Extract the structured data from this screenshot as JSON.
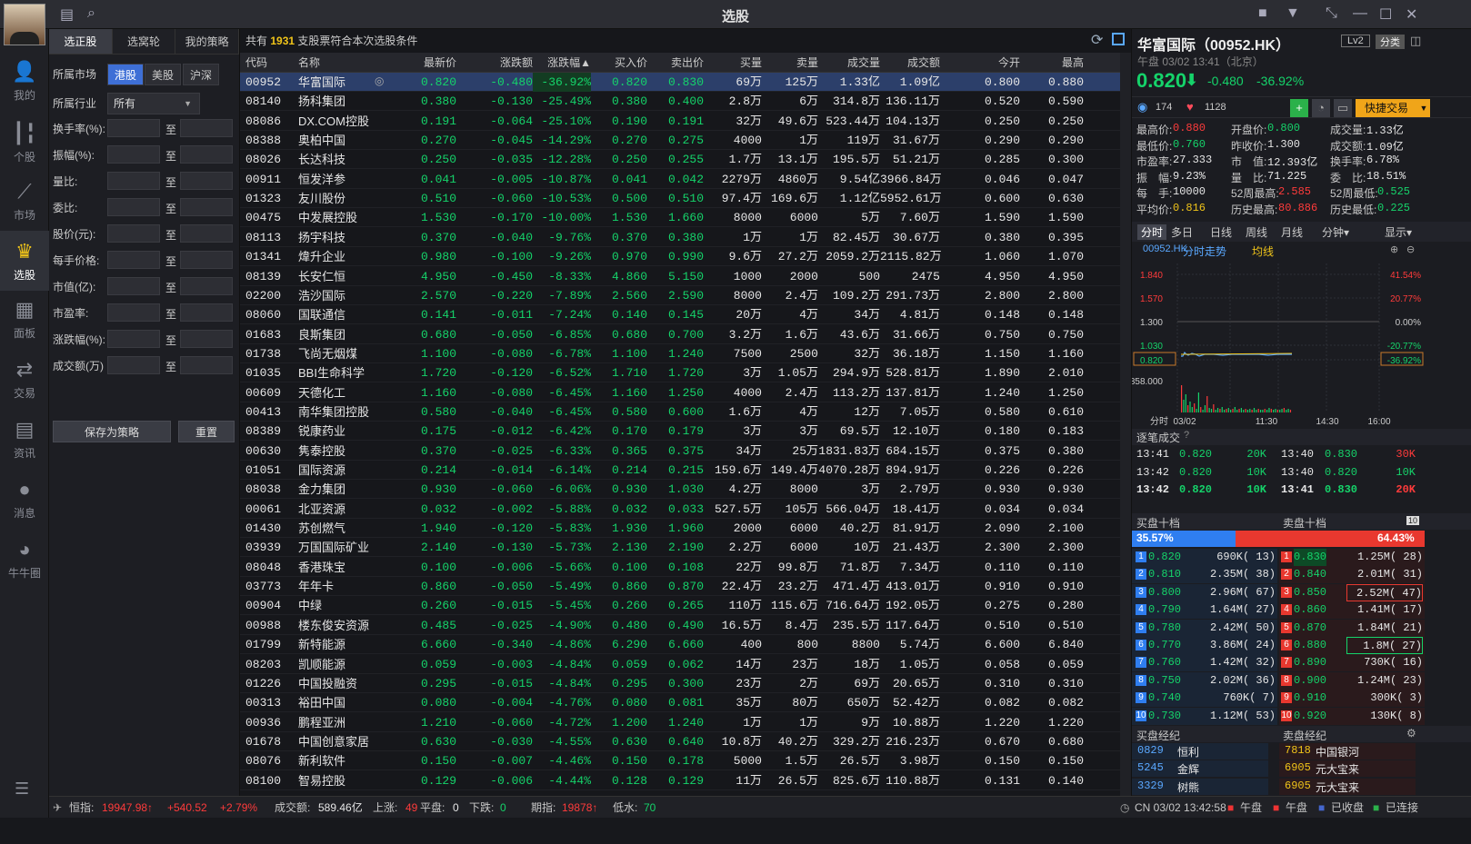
{
  "app": {
    "title": "选股"
  },
  "nav": [
    {
      "label": "我的",
      "icon": "user-icon"
    },
    {
      "label": "个股",
      "icon": "candlestick-icon"
    },
    {
      "label": "市场",
      "icon": "line-chart-icon"
    },
    {
      "label": "选股",
      "icon": "crown-icon"
    },
    {
      "label": "面板",
      "icon": "panel-icon"
    },
    {
      "label": "交易",
      "icon": "trade-icon"
    },
    {
      "label": "资讯",
      "icon": "news-icon"
    },
    {
      "label": "消息",
      "icon": "chat-icon"
    },
    {
      "label": "牛牛圈",
      "icon": "community-icon"
    }
  ],
  "filter": {
    "tabs": [
      "选正股",
      "选窝轮",
      "我的策略"
    ],
    "market_label": "所属市场",
    "markets": [
      "港股",
      "美股",
      "沪深"
    ],
    "industry_label": "所属行业",
    "industry_value": "所有",
    "to": "至",
    "fields": [
      "换手率(%):",
      "振幅(%):",
      "量比:",
      "委比:",
      "股价(元):",
      "每手价格:",
      "市值(亿):",
      "市盈率:",
      "涨跌幅(%):",
      "成交额(万)"
    ],
    "save_label": "保存为策略",
    "reset_label": "重置"
  },
  "summary": {
    "prefix": "共有",
    "count": "1931",
    "suffix": "支股票符合本次选股条件"
  },
  "columns": [
    "代码",
    "名称",
    "最新价",
    "涨跌额",
    "涨跌幅▲",
    "买入价",
    "卖出价",
    "买量",
    "卖量",
    "成交量",
    "成交额",
    "今开",
    "最高"
  ],
  "rows": [
    [
      "00952",
      "华富国际",
      "0.820",
      "-0.480",
      "-36.92%",
      "0.820",
      "0.830",
      "69万",
      "125万",
      "1.33亿",
      "1.09亿",
      "0.800",
      "0.880"
    ],
    [
      "08140",
      "扬科集团",
      "0.380",
      "-0.130",
      "-25.49%",
      "0.380",
      "0.400",
      "2.8万",
      "6万",
      "314.8万",
      "136.11万",
      "0.520",
      "0.590"
    ],
    [
      "08086",
      "DX.COM控股",
      "0.191",
      "-0.064",
      "-25.10%",
      "0.190",
      "0.191",
      "32万",
      "49.6万",
      "523.44万",
      "104.13万",
      "0.250",
      "0.250"
    ],
    [
      "08388",
      "奥柏中国",
      "0.270",
      "-0.045",
      "-14.29%",
      "0.270",
      "0.275",
      "4000",
      "1万",
      "119万",
      "31.67万",
      "0.290",
      "0.290"
    ],
    [
      "08026",
      "长达科技",
      "0.250",
      "-0.035",
      "-12.28%",
      "0.250",
      "0.255",
      "1.7万",
      "13.1万",
      "195.5万",
      "51.21万",
      "0.285",
      "0.300"
    ],
    [
      "00911",
      "恒发洋参",
      "0.041",
      "-0.005",
      "-10.87%",
      "0.041",
      "0.042",
      "2279万",
      "4860万",
      "9.54亿",
      "3966.84万",
      "0.046",
      "0.047"
    ],
    [
      "01323",
      "友川股份",
      "0.510",
      "-0.060",
      "-10.53%",
      "0.500",
      "0.510",
      "97.4万",
      "169.6万",
      "1.12亿",
      "5952.61万",
      "0.600",
      "0.630"
    ],
    [
      "00475",
      "中发展控股",
      "1.530",
      "-0.170",
      "-10.00%",
      "1.530",
      "1.660",
      "8000",
      "6000",
      "5万",
      "7.60万",
      "1.590",
      "1.590"
    ],
    [
      "08113",
      "扬宇科技",
      "0.370",
      "-0.040",
      "-9.76%",
      "0.370",
      "0.380",
      "1万",
      "1万",
      "82.45万",
      "30.67万",
      "0.380",
      "0.395"
    ],
    [
      "01341",
      "煒升企业",
      "0.980",
      "-0.100",
      "-9.26%",
      "0.970",
      "0.990",
      "9.6万",
      "27.2万",
      "2059.2万",
      "2115.82万",
      "1.060",
      "1.070"
    ],
    [
      "08139",
      "长安仁恒",
      "4.950",
      "-0.450",
      "-8.33%",
      "4.860",
      "5.150",
      "1000",
      "2000",
      "500",
      "2475",
      "4.950",
      "4.950"
    ],
    [
      "02200",
      "浩沙国际",
      "2.570",
      "-0.220",
      "-7.89%",
      "2.560",
      "2.590",
      "8000",
      "2.4万",
      "109.2万",
      "291.73万",
      "2.800",
      "2.800"
    ],
    [
      "08060",
      "国联通信",
      "0.141",
      "-0.011",
      "-7.24%",
      "0.140",
      "0.145",
      "20万",
      "4万",
      "34万",
      "4.81万",
      "0.148",
      "0.148"
    ],
    [
      "01683",
      "良斯集团",
      "0.680",
      "-0.050",
      "-6.85%",
      "0.680",
      "0.700",
      "3.2万",
      "1.6万",
      "43.6万",
      "31.66万",
      "0.750",
      "0.750"
    ],
    [
      "01738",
      "飞尚无烟煤",
      "1.100",
      "-0.080",
      "-6.78%",
      "1.100",
      "1.240",
      "7500",
      "2500",
      "32万",
      "36.18万",
      "1.150",
      "1.160"
    ],
    [
      "01035",
      "BBI生命科学",
      "1.720",
      "-0.120",
      "-6.52%",
      "1.710",
      "1.720",
      "3万",
      "1.05万",
      "294.9万",
      "528.81万",
      "1.890",
      "2.010"
    ],
    [
      "00609",
      "天德化工",
      "1.160",
      "-0.080",
      "-6.45%",
      "1.160",
      "1.250",
      "4000",
      "2.4万",
      "113.2万",
      "137.81万",
      "1.240",
      "1.250"
    ],
    [
      "00413",
      "南华集团控股",
      "0.580",
      "-0.040",
      "-6.45%",
      "0.580",
      "0.600",
      "1.6万",
      "4万",
      "12万",
      "7.05万",
      "0.580",
      "0.610"
    ],
    [
      "08389",
      "锐康药业",
      "0.175",
      "-0.012",
      "-6.42%",
      "0.170",
      "0.179",
      "3万",
      "3万",
      "69.5万",
      "12.10万",
      "0.180",
      "0.183"
    ],
    [
      "00630",
      "隽泰控股",
      "0.370",
      "-0.025",
      "-6.33%",
      "0.365",
      "0.375",
      "34万",
      "25万",
      "1831.83万",
      "684.15万",
      "0.375",
      "0.380"
    ],
    [
      "01051",
      "国际资源",
      "0.214",
      "-0.014",
      "-6.14%",
      "0.214",
      "0.215",
      "159.6万",
      "149.4万",
      "4070.28万",
      "894.91万",
      "0.226",
      "0.226"
    ],
    [
      "08038",
      "金力集团",
      "0.930",
      "-0.060",
      "-6.06%",
      "0.930",
      "1.030",
      "4.2万",
      "8000",
      "3万",
      "2.79万",
      "0.930",
      "0.930"
    ],
    [
      "00061",
      "北亚资源",
      "0.032",
      "-0.002",
      "-5.88%",
      "0.032",
      "0.033",
      "527.5万",
      "105万",
      "566.04万",
      "18.41万",
      "0.034",
      "0.034"
    ],
    [
      "01430",
      "苏创燃气",
      "1.940",
      "-0.120",
      "-5.83%",
      "1.930",
      "1.960",
      "2000",
      "6000",
      "40.2万",
      "81.91万",
      "2.090",
      "2.100"
    ],
    [
      "03939",
      "万国国际矿业",
      "2.140",
      "-0.130",
      "-5.73%",
      "2.130",
      "2.190",
      "2.2万",
      "6000",
      "10万",
      "21.43万",
      "2.300",
      "2.300"
    ],
    [
      "08048",
      "香港珠宝",
      "0.100",
      "-0.006",
      "-5.66%",
      "0.100",
      "0.108",
      "22万",
      "99.8万",
      "71.8万",
      "7.34万",
      "0.110",
      "0.110"
    ],
    [
      "03773",
      "年年卡",
      "0.860",
      "-0.050",
      "-5.49%",
      "0.860",
      "0.870",
      "22.4万",
      "23.2万",
      "471.4万",
      "413.01万",
      "0.910",
      "0.910"
    ],
    [
      "00904",
      "中绿",
      "0.260",
      "-0.015",
      "-5.45%",
      "0.260",
      "0.265",
      "110万",
      "115.6万",
      "716.64万",
      "192.05万",
      "0.275",
      "0.280"
    ],
    [
      "00988",
      "楼东俊安资源",
      "0.485",
      "-0.025",
      "-4.90%",
      "0.480",
      "0.490",
      "16.5万",
      "8.4万",
      "235.5万",
      "117.64万",
      "0.510",
      "0.510"
    ],
    [
      "01799",
      "新特能源",
      "6.660",
      "-0.340",
      "-4.86%",
      "6.290",
      "6.660",
      "400",
      "800",
      "8800",
      "5.74万",
      "6.600",
      "6.840"
    ],
    [
      "08203",
      "凯顺能源",
      "0.059",
      "-0.003",
      "-4.84%",
      "0.059",
      "0.062",
      "14万",
      "23万",
      "18万",
      "1.05万",
      "0.058",
      "0.059"
    ],
    [
      "01226",
      "中国投融资",
      "0.295",
      "-0.015",
      "-4.84%",
      "0.295",
      "0.300",
      "23万",
      "2万",
      "69万",
      "20.65万",
      "0.310",
      "0.310"
    ],
    [
      "00313",
      "裕田中国",
      "0.080",
      "-0.004",
      "-4.76%",
      "0.080",
      "0.081",
      "35万",
      "80万",
      "650万",
      "52.42万",
      "0.082",
      "0.082"
    ],
    [
      "00936",
      "鹏程亚洲",
      "1.210",
      "-0.060",
      "-4.72%",
      "1.200",
      "1.240",
      "1万",
      "1万",
      "9万",
      "10.88万",
      "1.220",
      "1.220"
    ],
    [
      "01678",
      "中国创意家居",
      "0.630",
      "-0.030",
      "-4.55%",
      "0.630",
      "0.640",
      "10.8万",
      "40.2万",
      "329.2万",
      "216.23万",
      "0.670",
      "0.680"
    ],
    [
      "08076",
      "新利软件",
      "0.150",
      "-0.007",
      "-4.46%",
      "0.150",
      "0.178",
      "5000",
      "1.5万",
      "26.5万",
      "3.98万",
      "0.150",
      "0.150"
    ],
    [
      "08100",
      "智易控股",
      "0.129",
      "-0.006",
      "-4.44%",
      "0.128",
      "0.129",
      "11万",
      "26.5万",
      "825.6万",
      "110.88万",
      "0.131",
      "0.140"
    ]
  ],
  "quote": {
    "name": "华富国际（00952.HK）",
    "lv": "Lv2",
    "fenpan": "分类",
    "session": "午盘 03/02 13:41（北京）",
    "price": "0.820",
    "change": "-0.480",
    "pct": "-36.92%",
    "views": "174",
    "likes": "1128",
    "quick_trade": "快捷交易",
    "stats": [
      [
        "最高价:",
        "0.880",
        "up"
      ],
      [
        "开盘价:",
        "0.800",
        "dn"
      ],
      [
        "成交量:",
        "1.33亿",
        "wh"
      ],
      [
        "最低价:",
        "0.760",
        "dn"
      ],
      [
        "昨收价:",
        "1.300",
        "wh"
      ],
      [
        "成交额:",
        "1.09亿",
        "wh"
      ],
      [
        "市盈率:",
        "27.333",
        "wh"
      ],
      [
        "市　值:",
        "12.393亿",
        "wh"
      ],
      [
        "换手率:",
        "6.78%",
        "wh"
      ],
      [
        "振　幅:",
        "9.23%",
        "wh"
      ],
      [
        "量　比:",
        "71.225",
        "wh"
      ],
      [
        "委　比:",
        "18.51%",
        "wh"
      ],
      [
        "每　手:",
        "10000",
        "wh"
      ],
      [
        "52周最高:",
        "2.585",
        "up"
      ],
      [
        "52周最低:",
        "0.525",
        "dn"
      ],
      [
        "平均价:",
        "0.816",
        "yl"
      ],
      [
        "历史最高:",
        "80.886",
        "up"
      ],
      [
        "历史最低:",
        "0.225",
        "dn"
      ]
    ]
  },
  "chart_tabs": [
    "分时",
    "多日",
    "日线",
    "周线",
    "月线",
    "分钟▾"
  ],
  "chart_show": "显示▾",
  "chart_legend": {
    "code": "00952.HK",
    "trend": "分时走势",
    "avg": "均线"
  },
  "chart": {
    "y_left": [
      "1.840",
      "1.570",
      "1.300",
      "1.030",
      "0.820"
    ],
    "y_right": [
      "41.54%",
      "20.77%",
      "0.00%",
      "-20.77%",
      "-36.92%"
    ],
    "vol_label": "858.000",
    "x_labels": [
      "分时",
      "03/02",
      "11:30",
      "14:30",
      "16:00"
    ]
  },
  "ticks_title": "逐笔成交",
  "ticks": [
    [
      "13:41",
      "0.820",
      "20K",
      "dn",
      "13:40",
      "0.830",
      "30K",
      "up"
    ],
    [
      "13:42",
      "0.820",
      "10K",
      "dn",
      "13:40",
      "0.820",
      "10K",
      "dn"
    ],
    [
      "13:42",
      "0.820",
      "10K",
      "dn",
      "13:41",
      "0.830",
      "20K",
      "up"
    ]
  ],
  "book": {
    "bid_title": "买盘十档",
    "ask_title": "卖盘十档",
    "bid_pct": "35.57%",
    "ask_pct": "64.43%",
    "rows": [
      [
        "0.820",
        "690K( 13)",
        "0.830",
        "1.25M( 28)"
      ],
      [
        "0.810",
        "2.35M( 38)",
        "0.840",
        "2.01M( 31)"
      ],
      [
        "0.800",
        "2.96M( 67)",
        "0.850",
        "2.52M( 47)"
      ],
      [
        "0.790",
        "1.64M( 27)",
        "0.860",
        "1.41M( 17)"
      ],
      [
        "0.780",
        "2.42M( 50)",
        "0.870",
        "1.84M( 21)"
      ],
      [
        "0.770",
        "3.86M( 24)",
        "0.880",
        "1.8M( 27)"
      ],
      [
        "0.760",
        "1.42M( 32)",
        "0.890",
        "730K( 16)"
      ],
      [
        "0.750",
        "2.02M( 36)",
        "0.900",
        "1.24M( 23)"
      ],
      [
        "0.740",
        "760K( 7)",
        "0.910",
        "300K( 3)"
      ],
      [
        "0.730",
        "1.12M( 53)",
        "0.920",
        "130K( 8)"
      ]
    ]
  },
  "brokers": {
    "bid_title": "买盘经纪",
    "ask_title": "卖盘经纪",
    "bid": [
      [
        "0829",
        "恒利"
      ],
      [
        "5245",
        "金辉"
      ],
      [
        "3329",
        "树熊"
      ]
    ],
    "ask": [
      [
        "7818",
        "中国银河"
      ],
      [
        "6905",
        "元大宝来"
      ],
      [
        "6905",
        "元大宝来"
      ]
    ]
  },
  "status": {
    "hsi_label": "恒指:",
    "hsi": "19947.98↑",
    "hsi_chg": "+540.52",
    "hsi_pct": "+2.79%",
    "turnover_label": "成交额:",
    "turnover": "589.46亿",
    "up_label": "上涨:",
    "up": "49",
    "flat_label": "平盘:",
    "flat": "0",
    "down_label": "下跌:",
    "down": "0",
    "fut_label": "期指:",
    "fut": "19878↑",
    "low_label": "低水:",
    "low": "70",
    "clock": "CN 03/02 13:42:58",
    "s1": "午盘",
    "s2": "午盘",
    "s3": "已收盘",
    "s4": "已连接"
  },
  "colors": {
    "up": "#ff3b3b",
    "down": "#15d36a",
    "accent": "#3e6fd6",
    "selected_row": "#2c3f6a"
  }
}
